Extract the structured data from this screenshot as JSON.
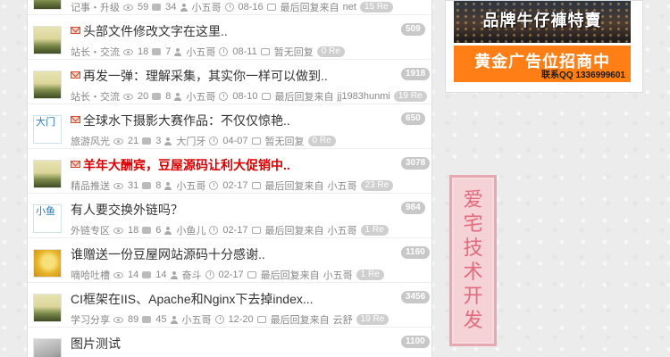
{
  "colors": {
    "accent_red": "#d90000",
    "badge_gray": "#c8c8c8",
    "ad_orange": "#ff7f16",
    "seal_pink": "#e26b7d"
  },
  "topics": [
    {
      "title": "",
      "category": "记事・升级",
      "views": "59",
      "replies": "34",
      "author": "小五哥",
      "date": "08-16",
      "last_reply": "最后回复来自",
      "last_user": "net",
      "re": "15 Re",
      "count": "",
      "avatar": "default",
      "avatar_text": "",
      "mail": false,
      "hot": false
    },
    {
      "title": "头部文件修改文字在这里..",
      "category": "站长・交流",
      "views": "18",
      "replies": "7",
      "author": "小五哥",
      "date": "08-11",
      "last_reply": "暂无回复",
      "last_user": "",
      "re": "0 Re",
      "count": "509",
      "avatar": "default",
      "avatar_text": "",
      "mail": true,
      "hot": false
    },
    {
      "title": "再发一弹：理解采集，其实你一样可以做到..",
      "category": "站长・交流",
      "views": "20",
      "replies": "8",
      "author": "小五哥",
      "date": "08-10",
      "last_reply": "最后回复来自",
      "last_user": "jj1983hunmi",
      "re": "19 Re",
      "count": "1918",
      "avatar": "default",
      "avatar_text": "",
      "mail": true,
      "hot": false
    },
    {
      "title": "全球水下摄影大赛作品：不仅仅惊艳..",
      "category": "旅游风光",
      "views": "21",
      "replies": "3",
      "author": "大门牙",
      "date": "04-07",
      "last_reply": "暂无回复",
      "last_user": "",
      "re": "0 Re",
      "count": "650",
      "avatar": "text",
      "avatar_text": "大门",
      "mail": true,
      "hot": false
    },
    {
      "title": "羊年大酬宾，豆屋源码让利大促销中..",
      "category": "精品推送",
      "views": "31",
      "replies": "8",
      "author": "小五哥",
      "date": "02-17",
      "last_reply": "最后回复来自",
      "last_user": "小五哥",
      "re": "23 Re",
      "count": "3078",
      "avatar": "default",
      "avatar_text": "",
      "mail": true,
      "hot": true
    },
    {
      "title": "有人要交换外链吗？",
      "category": "外链专区",
      "views": "18",
      "replies": "6",
      "author": "小鱼儿",
      "date": "02-17",
      "last_reply": "最后回复来自",
      "last_user": "小五哥",
      "re": "1 Re",
      "count": "984",
      "avatar": "text",
      "avatar_text": "小鱼",
      "mail": false,
      "hot": false
    },
    {
      "title": "谁赠送一份豆屋网站源码十分感谢..",
      "category": "嘀哈吐槽",
      "views": "14",
      "replies": "14",
      "author": "奋斗",
      "date": "02-17",
      "last_reply": "最后回复来自",
      "last_user": "小五哥",
      "re": "1 Re",
      "count": "1160",
      "avatar": "yellow",
      "avatar_text": "",
      "mail": false,
      "hot": false
    },
    {
      "title": "CI框架在IIS、Apache和Nginx下去掉index...",
      "category": "学习分享",
      "views": "89",
      "replies": "45",
      "author": "小五哥",
      "date": "12-20",
      "last_reply": "最后回复来自",
      "last_user": "云舒",
      "re": "19 Re",
      "count": "3456",
      "avatar": "default",
      "avatar_text": "",
      "mail": false,
      "hot": false
    },
    {
      "title": "图片测试",
      "category": "旅游风光",
      "views": "16",
      "replies": "1",
      "author": "秦丽士丽",
      "date": "12-05",
      "last_reply": "最后回复来自",
      "last_user": "小五哥",
      "re": "1 Re",
      "count": "1100",
      "avatar": "gray",
      "avatar_text": "",
      "mail": false,
      "hot": false
    }
  ],
  "ads": {
    "banner_text": "品牌牛仔褲特賣",
    "gold_text": "黄金广告位招商中",
    "contact": "联系QQ 1336999601"
  },
  "seal_text": "爱宅技术开发"
}
